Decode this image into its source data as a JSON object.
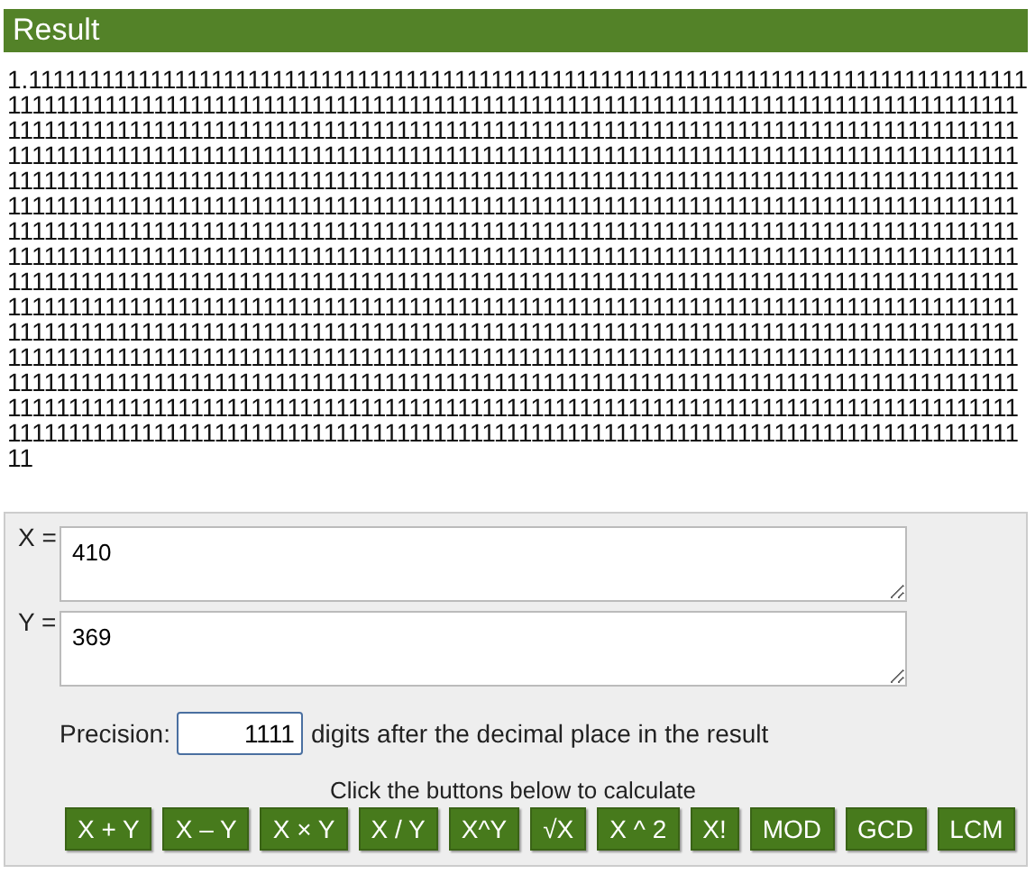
{
  "result": {
    "title": "Result",
    "value": "1.1111111111111111111111111111111111111111111111111111111111111111111111111111111111111111111111111111111111111111111111111111111111111111111111111111111111111111111111111111111111111111111111111111111111111111111111111111111111111111111111111111111111111111111111111111111111111111111111111111111111111111111111111111111111111111111111111111111111111111111111111111111111111111111111111111111111111111111111111111111111111111111111111111111111111111111111111111111111111111111111111111111111111111111111111111111111111111111111111111111111111111111111111111111111111111111111111111111111111111111111111111111111111111111111111111111111111111111111111111111111111111111111111111111111111111111111111111111111111111111111111111111111111111111111111111111111111111111111111111111111111111111111111111111111111111111111111111111111111111111111111111111111111111111111111111111111111111111111111111111111111111111111111111111111111111111111111111111111111111111111111111111111111111111111111111111111111111111111111111111111111111111111111111111111111111111111111111111111111111111111111111111111111111111111111111111111111111111111111111111111111111111111111111111111111111111111111111111111111111111111111111111111111111111111111111111111111111111111"
  },
  "inputs": [
    {
      "label": "X =",
      "value": "410"
    },
    {
      "label": "Y =",
      "value": "369"
    }
  ],
  "precision": {
    "label": "Precision:",
    "value": "1111",
    "suffix": "digits after the decimal place in the result"
  },
  "hint": "Click the buttons below to calculate",
  "buttons": [
    "X + Y",
    "X – Y",
    "X × Y",
    "X / Y",
    "X^Y",
    "√X",
    "X ^ 2",
    "X!",
    "MOD",
    "GCD",
    "LCM"
  ]
}
